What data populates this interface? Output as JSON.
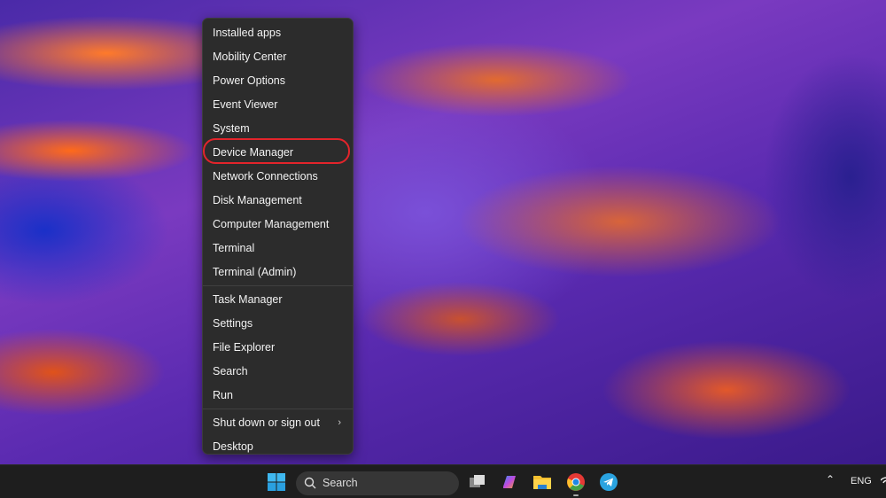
{
  "context_menu": {
    "groups": [
      [
        "Installed apps",
        "Mobility Center",
        "Power Options",
        "Event Viewer",
        "System",
        "Device Manager",
        "Network Connections",
        "Disk Management",
        "Computer Management",
        "Terminal",
        "Terminal (Admin)"
      ],
      [
        "Task Manager",
        "Settings",
        "File Explorer",
        "Search",
        "Run"
      ],
      [
        "Shut down or sign out",
        "Desktop"
      ]
    ],
    "highlighted_item": "Device Manager",
    "highlight_color": "#e3242b"
  },
  "taskbar": {
    "search_label": "Search",
    "apps": [
      "start-icon",
      "task-view-icon",
      "copilot-icon",
      "file-explorer-icon",
      "chrome-icon",
      "telegram-icon"
    ],
    "tray": {
      "language": "ENG"
    }
  }
}
